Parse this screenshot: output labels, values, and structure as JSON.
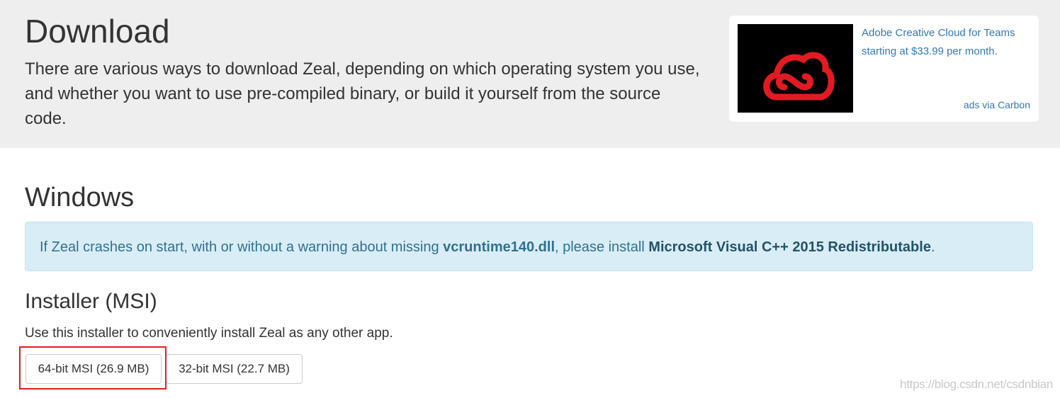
{
  "hero": {
    "title": "Download",
    "lead": "There are various ways to download Zeal, depending on which operating system you use, and whether you want to use pre-compiled binary, or build it yourself from the source code."
  },
  "ad": {
    "text": "Adobe Creative Cloud for Teams starting at $33.99 per month.",
    "via": "ads via Carbon",
    "logo_color": "#e21b23",
    "image_icon": "adobe-creative-cloud-logo"
  },
  "windows": {
    "title": "Windows",
    "alert": {
      "prefix": "If Zeal crashes on start, with or without a warning about missing ",
      "dll": "vcruntime140.dll",
      "middle": ", please install ",
      "link": "Microsoft Visual C++ 2015 Redistributable",
      "suffix": "."
    },
    "installer": {
      "title": "Installer (MSI)",
      "description": "Use this installer to conveniently install Zeal as any other app.",
      "buttons": [
        {
          "label": "64-bit MSI (26.9 MB)"
        },
        {
          "label": "32-bit MSI (22.7 MB)"
        }
      ]
    }
  },
  "watermark": "https://blog.csdn.net/csdnbian",
  "colors": {
    "hero_bg": "#eeeeee",
    "link": "#337ab7",
    "alert_bg": "#d9edf7",
    "alert_text": "#31708f",
    "highlight": "#e0201c"
  }
}
